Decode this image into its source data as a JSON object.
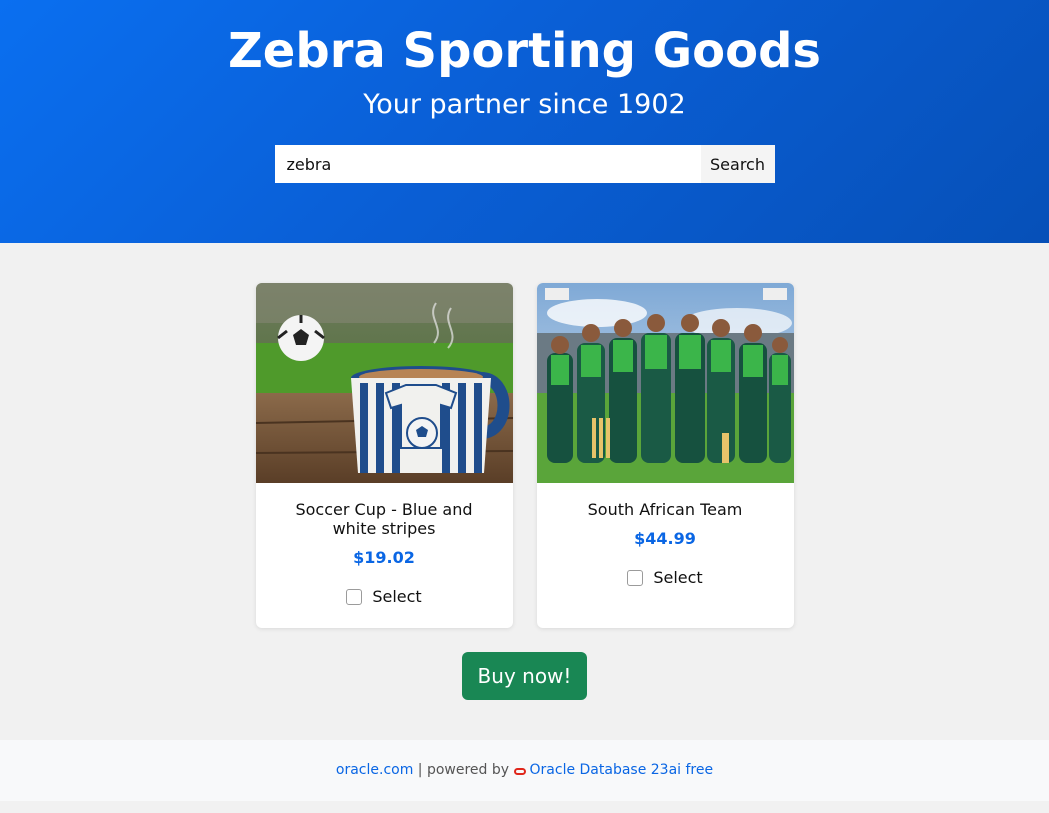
{
  "header": {
    "title": "Zebra Sporting Goods",
    "subtitle": "Your partner since 1902"
  },
  "search": {
    "value": "zebra",
    "placeholder": "",
    "button_label": "Search"
  },
  "products": [
    {
      "name": "Soccer Cup - Blue and white stripes",
      "price": "$19.02",
      "select_label": "Select",
      "selected": false
    },
    {
      "name": "South African Team",
      "price": "$44.99",
      "select_label": "Select",
      "selected": false
    }
  ],
  "buy_label": "Buy now!",
  "footer": {
    "link1": "oracle.com",
    "separator": "| powered by",
    "link2": "Oracle Database 23ai free"
  },
  "colors": {
    "hero": "#0a5fd6",
    "price": "#0a66e4",
    "buy_button": "#198754",
    "oracle_red": "#e0271b"
  }
}
